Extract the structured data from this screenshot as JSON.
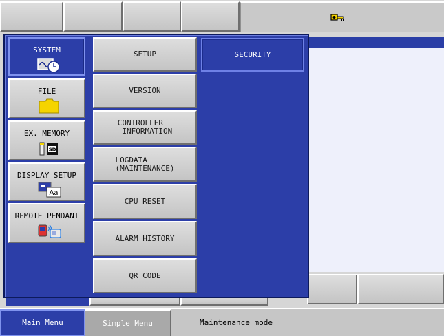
{
  "status_icon": "robot-key-icon",
  "left_menu": [
    {
      "label": "SYSTEM",
      "icon": "system-clock-icon",
      "active": true
    },
    {
      "label": "FILE",
      "icon": "folder-icon",
      "active": false
    },
    {
      "label": "EX. MEMORY",
      "icon": "sd-card-icon",
      "active": false
    },
    {
      "label": "DISPLAY SETUP",
      "icon": "display-font-icon",
      "active": false
    },
    {
      "label": "REMOTE PENDANT",
      "icon": "pendant-icon",
      "active": false
    }
  ],
  "submenu": [
    "SETUP",
    "VERSION",
    "CONTROLLER\n INFORMATION",
    "LOGDATA\n(MAINTENANCE)",
    "CPU RESET",
    "ALARM HISTORY",
    "QR CODE"
  ],
  "sub_submenu": [
    "SECURITY"
  ],
  "bottom": {
    "main_menu": "Main Menu",
    "simple_menu": "Simple Menu",
    "status": "Maintenance mode"
  },
  "colors": {
    "panel": "#2c3ea8",
    "button": "#d0d0d0",
    "highlight": "#7f92ee",
    "icon_yellow": "#f5d400"
  }
}
